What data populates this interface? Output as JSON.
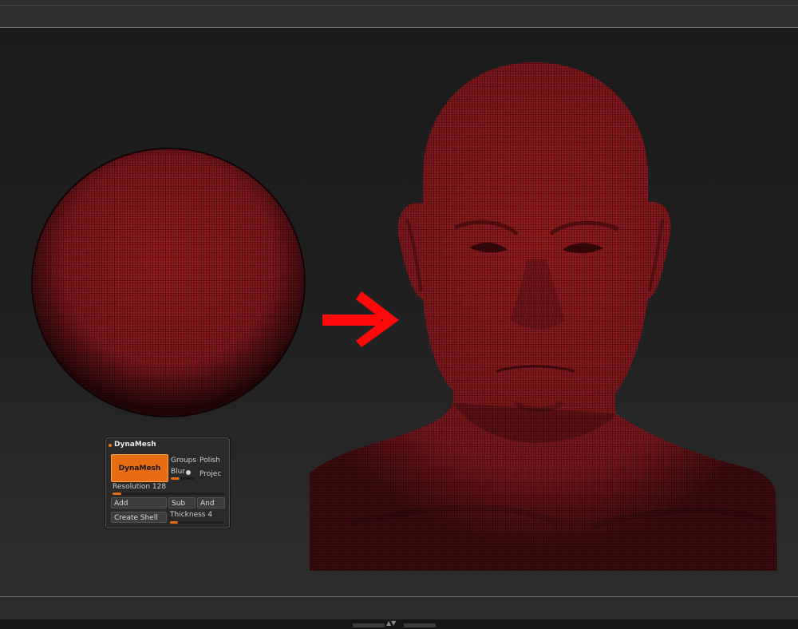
{
  "panel": {
    "title": "DynaMesh",
    "main_button": "DynaMesh",
    "groups": "Groups",
    "polish": "Polish",
    "blur": "Blur",
    "blur_value": 2,
    "project": "Projec",
    "resolution_label": "Resolution",
    "resolution_value": "128",
    "resolution_fill": 0.08,
    "add": "Add",
    "sub": "Sub",
    "and": "And",
    "create_shell": "Create Shell",
    "thickness_label": "Thickness",
    "thickness_value": "4",
    "thickness_fill": 0.14,
    "blur_fill": 0.35
  },
  "colors": {
    "accent": "#e76c12",
    "mesh": "#8a1a1d",
    "arrow": "#ff0a0a",
    "background": "#1d1d1d"
  }
}
